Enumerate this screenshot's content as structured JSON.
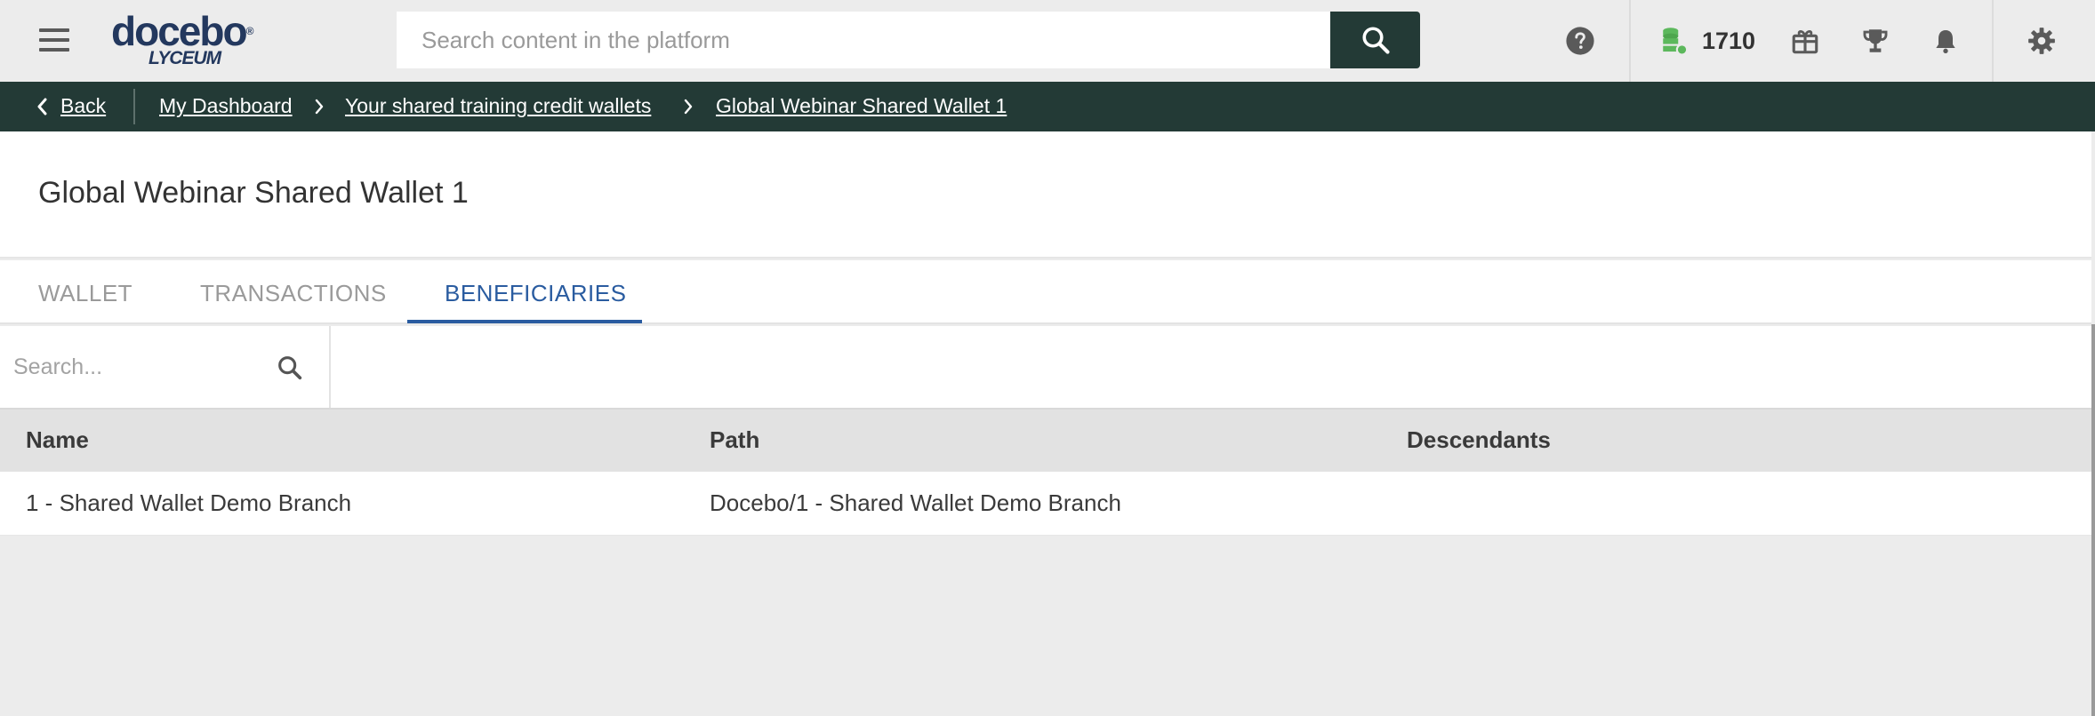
{
  "header": {
    "logo_text": "docebo",
    "logo_sub": "LYCEUM",
    "search_placeholder": "Search content in the platform",
    "credits": "1710"
  },
  "breadcrumb": {
    "back_label": "Back",
    "items": [
      {
        "label": "My Dashboard"
      },
      {
        "label": "Your shared training credit wallets"
      },
      {
        "label": "Global Webinar Shared Wallet 1"
      }
    ]
  },
  "page": {
    "title": "Global Webinar Shared Wallet 1"
  },
  "tabs": [
    {
      "label": "WALLET",
      "active": false
    },
    {
      "label": "TRANSACTIONS",
      "active": false
    },
    {
      "label": "BENEFICIARIES",
      "active": true
    }
  ],
  "filter": {
    "search_placeholder": "Search..."
  },
  "table": {
    "columns": [
      "Name",
      "Path",
      "Descendants"
    ],
    "rows": [
      [
        "1 - Shared Wallet Demo Branch",
        "Docebo/1 - Shared Wallet Demo Branch",
        ""
      ]
    ]
  },
  "colors": {
    "accent": "#2a5ca0",
    "dark_bar": "#233a36",
    "brand": "#23385e",
    "credit_icon": "#5cb85c"
  }
}
